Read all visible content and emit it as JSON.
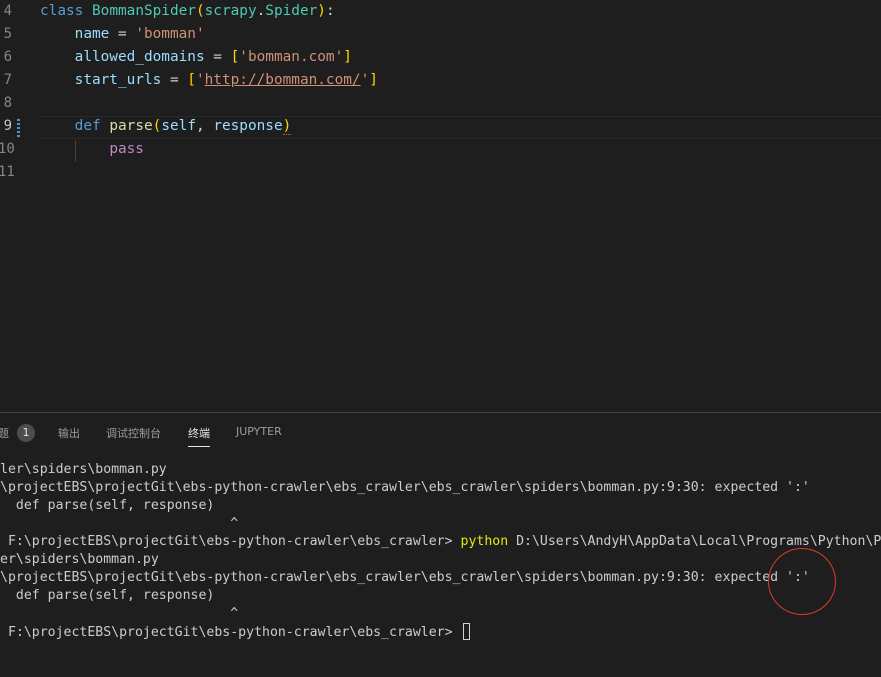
{
  "editor": {
    "lines": [
      {
        "num": "4",
        "tokens": [
          {
            "t": "class",
            "c": "kw"
          },
          {
            "t": " "
          },
          {
            "t": "BommanSpider",
            "c": "cls"
          },
          {
            "t": "(",
            "c": "brk"
          },
          {
            "t": "scrapy",
            "c": "cls"
          },
          {
            "t": "."
          },
          {
            "t": "Spider",
            "c": "cls"
          },
          {
            "t": ")",
            "c": "brk"
          },
          {
            "t": ":"
          }
        ]
      },
      {
        "num": "5",
        "tokens": [
          {
            "t": "    "
          },
          {
            "t": "name",
            "c": "var"
          },
          {
            "t": " = "
          },
          {
            "t": "'bomman'",
            "c": "str"
          }
        ]
      },
      {
        "num": "6",
        "tokens": [
          {
            "t": "    "
          },
          {
            "t": "allowed_domains",
            "c": "var"
          },
          {
            "t": " = "
          },
          {
            "t": "[",
            "c": "brk"
          },
          {
            "t": "'bomman.com'",
            "c": "str"
          },
          {
            "t": "]",
            "c": "brk"
          }
        ]
      },
      {
        "num": "7",
        "tokens": [
          {
            "t": "    "
          },
          {
            "t": "start_urls",
            "c": "var"
          },
          {
            "t": " = "
          },
          {
            "t": "[",
            "c": "brk"
          },
          {
            "t": "'",
            "c": "str"
          },
          {
            "t": "http://bomman.com/",
            "c": "str url"
          },
          {
            "t": "'",
            "c": "str"
          },
          {
            "t": "]",
            "c": "brk"
          }
        ]
      },
      {
        "num": "8",
        "tokens": []
      },
      {
        "num": "9",
        "active": true,
        "tokens": [
          {
            "t": "    "
          },
          {
            "t": "def",
            "c": "kw"
          },
          {
            "t": " "
          },
          {
            "t": "parse",
            "c": "fn"
          },
          {
            "t": "(",
            "c": "brk"
          },
          {
            "t": "self",
            "c": "var"
          },
          {
            "t": ", "
          },
          {
            "t": "response",
            "c": "var"
          },
          {
            "t": ")",
            "c": "brk squiggle"
          }
        ]
      },
      {
        "num": "10",
        "tokens": [
          {
            "t": "        "
          },
          {
            "t": "pass",
            "c": "ctl"
          }
        ]
      },
      {
        "num": "11",
        "tokens": []
      }
    ]
  },
  "panel": {
    "tabs": {
      "problems_label": "题",
      "problems_count": "1",
      "output_label": "输出",
      "debug_console_label": "调试控制台",
      "terminal_label": "终端",
      "jupyter_label": "JUPYTER"
    },
    "terminal_lines": [
      {
        "text": "ler\\spiders\\bomman.py"
      },
      {
        "text": "\\projectEBS\\projectGit\\ebs-python-crawler\\ebs_crawler\\ebs_crawler\\spiders\\bomman.py:9:30: expected ':'"
      },
      {
        "text": "  def parse(self, response)"
      },
      {
        "text": "                             ^"
      },
      {
        "prompt": " F:\\projectEBS\\projectGit\\ebs-python-crawler\\ebs_crawler> ",
        "cmd": "python",
        "text": " D:\\Users\\AndyH\\AppData\\Local\\Programs\\Python\\P"
      },
      {
        "text": "er\\spiders\\bomman.py"
      },
      {
        "text": "\\projectEBS\\projectGit\\ebs-python-crawler\\ebs_crawler\\ebs_crawler\\spiders\\bomman.py:9:30: expected ':'"
      },
      {
        "text": "  def parse(self, response)"
      },
      {
        "text": "                             ^"
      },
      {
        "prompt": " F:\\projectEBS\\projectGit\\ebs-python-crawler\\ebs_crawler> ",
        "cursor": true
      }
    ]
  },
  "colors": {
    "background": "#1e1e1e",
    "keyword": "#569cd6",
    "class_name": "#4ec9b0",
    "string": "#ce9178",
    "variable": "#9cdcfe",
    "function": "#dcdcaa",
    "bracket": "#ffd700",
    "control": "#c586c0",
    "terminal_command": "#e5e510",
    "annotation_circle": "#d93a2b"
  },
  "icons": {
    "terminal_cursor": "cursor-block-icon",
    "annotation": "red-circle-annotation"
  }
}
